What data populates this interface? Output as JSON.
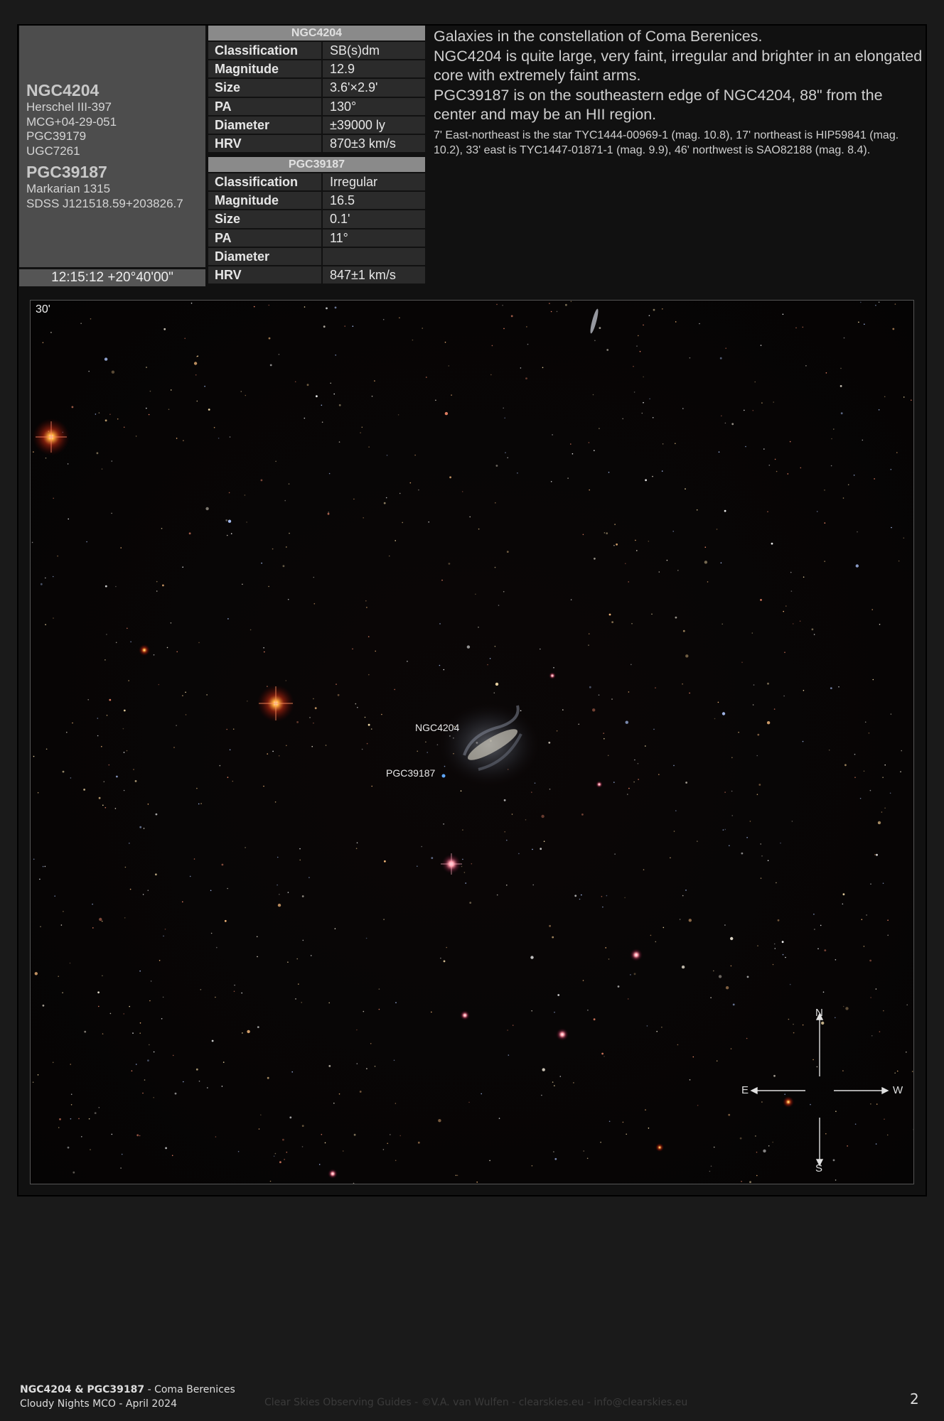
{
  "objects": {
    "primary": "NGC4204",
    "primary_aliases": [
      "Herschel III-397",
      "MCG+04-29-051",
      "PGC39179",
      "UGC7261"
    ],
    "secondary": "PGC39187",
    "secondary_aliases": [
      "Markarian 1315",
      "SDSS J121518.59+203826.7"
    ],
    "coordinates": "12:15:12 +20°40'00\""
  },
  "table_labels": {
    "classification": "Classification",
    "magnitude": "Magnitude",
    "size": "Size",
    "pa": "PA",
    "diameter": "Diameter",
    "hrv": "HRV"
  },
  "ngc4204": {
    "title": "NGC4204",
    "classification": "SB(s)dm",
    "magnitude": "12.9",
    "size": "3.6'×2.9'",
    "pa": "130°",
    "diameter": "±39000 ly",
    "hrv": "870±3 km/s"
  },
  "pgc39187": {
    "title": "PGC39187",
    "classification": "Irregular",
    "magnitude": "16.5",
    "size": "0.1'",
    "pa": "11°",
    "diameter": "",
    "hrv": "847±1 km/s"
  },
  "description": {
    "line1": "Galaxies in the constellation of Coma Berenices.",
    "line2": "NGC4204 is quite large, very faint, irregular and brighter in an elongated core with extremely faint arms.",
    "line3": "PGC39187 is on the southeastern edge of NGC4204, 88\" from the center and may be an HII region.",
    "line4": "7' East-northeast is the star TYC1444-00969-1 (mag. 10.8), 17' northeast is HIP59841 (mag. 10.2), 33' east is TYC1447-01871-1 (mag. 9.9), 46' northwest is SAO82188 (mag. 8.4)."
  },
  "image": {
    "scale": "30'",
    "label_ngc": "NGC4204",
    "label_pgc": "PGC39187",
    "compass": {
      "n": "N",
      "s": "S",
      "e": "E",
      "w": "W"
    }
  },
  "footer": {
    "title_bold": "NGC4204 & PGC39187",
    "title_rest": " - Coma Berenices",
    "subtitle": "Cloudy Nights MCO - April 2024",
    "credit": "Clear Skies Observing Guides - ©V.A. van Wulfen - clearskies.eu - info@clearskies.eu",
    "page": "2"
  }
}
